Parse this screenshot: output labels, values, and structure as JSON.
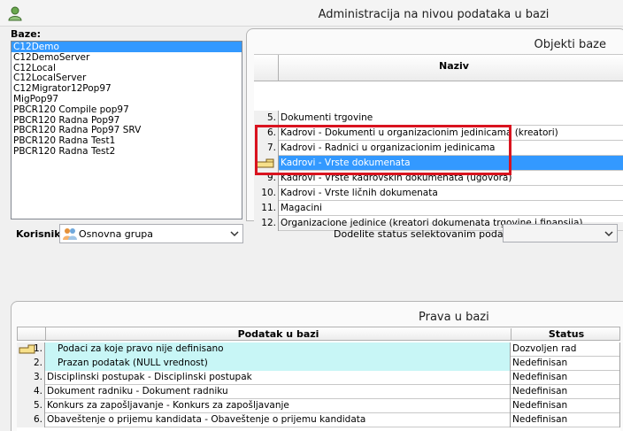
{
  "window": {
    "title": "Administracija na nivou podataka u bazi"
  },
  "baze": {
    "label": "Baze:",
    "items": [
      {
        "label": "C12Demo",
        "selected": true
      },
      {
        "label": "C12DemoServer"
      },
      {
        "label": "C12Local"
      },
      {
        "label": "C12LocalServer"
      },
      {
        "label": "C12Migrator12Pop97"
      },
      {
        "label": "MigPop97"
      },
      {
        "label": "PBCR120 Compile pop97"
      },
      {
        "label": "PBCR120 Radna Pop97"
      },
      {
        "label": "PBCR120 Radna Pop97 SRV"
      },
      {
        "label": "PBCR120 Radna Test1"
      },
      {
        "label": "PBCR120 Radna Test2"
      }
    ]
  },
  "korisnik": {
    "label": "Korisnik:",
    "value": "Osnovna grupa",
    "icon": "user-group-icon"
  },
  "objekti": {
    "title": "Objekti baze",
    "column": "Naziv",
    "rows": [
      {
        "num": "5.",
        "name": "Dokumenti trgovine"
      },
      {
        "num": "6.",
        "name": "Kadrovi - Dokumenti u organizacionim jedinicama (kreatori)"
      },
      {
        "num": "7.",
        "name": "Kadrovi - Radnici u organizacionim jedinicama"
      },
      {
        "num": "",
        "name": "Kadrovi - Vrste dokumenata",
        "selected": true
      },
      {
        "num": "9.",
        "name": "Kadrovi - Vrste kadrovskih dokumenata (ugovora)"
      },
      {
        "num": "10.",
        "name": "Kadrovi - Vrste ličnih dokumenata"
      },
      {
        "num": "11.",
        "name": "Magacini"
      },
      {
        "num": "12.",
        "name": "Organizacione jedinice (kreatori dokumenata trgovine i finansija)"
      }
    ]
  },
  "dodelite": {
    "label": "Dodelite status selektovanim podacima:",
    "value": ""
  },
  "prava": {
    "title": "Prava u bazi",
    "columns": {
      "podatak": "Podatak u bazi",
      "status": "Status"
    },
    "rows": [
      {
        "num": "1.",
        "podatak": "Podaci za koje pravo nije definisano",
        "status": "Dozvoljen rad",
        "highlight": true,
        "pointer": true
      },
      {
        "num": "2.",
        "podatak": "Prazan podatak (NULL vrednost)",
        "status": "Nedefinisan",
        "highlight": true
      },
      {
        "num": "3.",
        "podatak": "Disciplinski postupak - Disciplinski postupak",
        "status": "Nedefinisan"
      },
      {
        "num": "4.",
        "podatak": "Dokument radniku - Dokument radniku",
        "status": "Nedefinisan"
      },
      {
        "num": "5.",
        "podatak": "Konkurs za zapošljavanje - Konkurs za zapošljavanje",
        "status": "Nedefinisan"
      },
      {
        "num": "6.",
        "podatak": "Obaveštenje o prijemu kandidata - Obaveštenje o prijemu kandidata",
        "status": "Nedefinisan"
      }
    ]
  },
  "colors": {
    "selection": "#3399ff",
    "highlight_row": "#c8f6f6",
    "annotation_box": "#d9131f"
  }
}
